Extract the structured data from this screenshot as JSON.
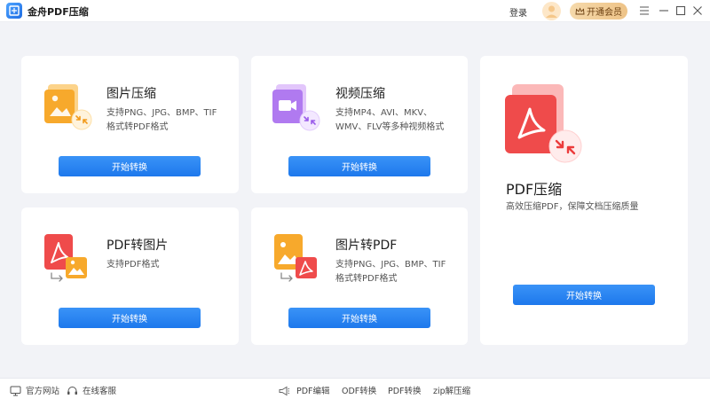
{
  "app": {
    "title": "金舟PDF压缩"
  },
  "header": {
    "login_label": "登录",
    "vip_label": "开通会员"
  },
  "cards": [
    {
      "title": "图片压缩",
      "desc_line1": "支持PNG、JPG、BMP、TIF",
      "desc_line2": "格式转PDF格式",
      "button_label": "开始转换"
    },
    {
      "title": "视频压缩",
      "desc_line1": "支持MP4、AVI、MKV、",
      "desc_line2": "WMV、FLV等多种视频格式",
      "button_label": "开始转换"
    },
    {
      "title": "PDF压缩",
      "desc_line1": "高效压缩PDF，保障文档压缩质量",
      "button_label": "开始转换"
    },
    {
      "title": "PDF转图片",
      "desc_line1": "支持PDF格式",
      "button_label": "开始转换"
    },
    {
      "title": "图片转PDF",
      "desc_line1": "支持PNG、JPG、BMP、TIF",
      "desc_line2": "格式转PDF格式",
      "button_label": "开始转换"
    }
  ],
  "footer": {
    "website_label": "官方网站",
    "support_label": "在线客服",
    "links": [
      "PDF编辑",
      "ODF转换",
      "PDF转换",
      "zip解压缩"
    ]
  },
  "colors": {
    "accent": "#2a86f2",
    "vip": "#eec387"
  }
}
